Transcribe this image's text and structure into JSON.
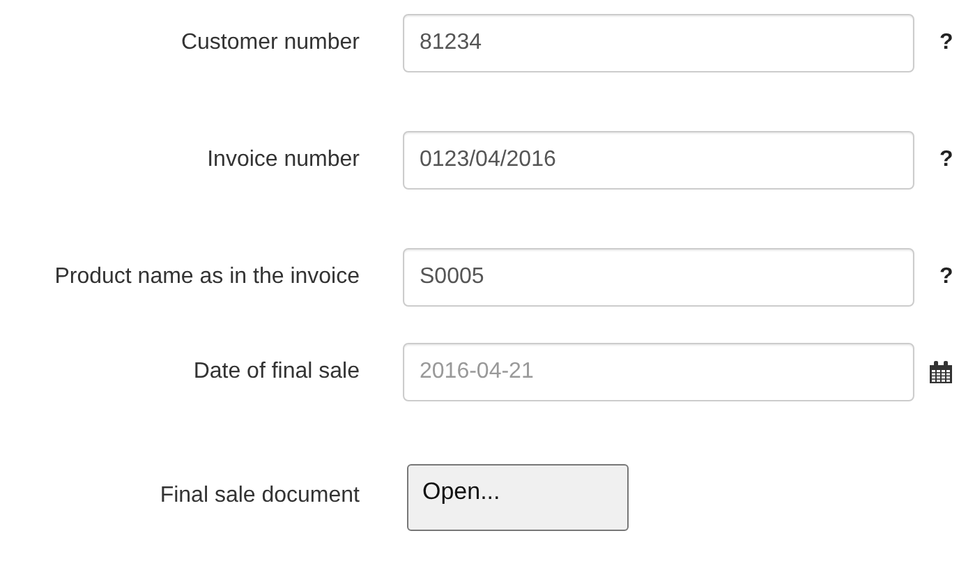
{
  "fields": [
    {
      "kind": "text",
      "label": "Customer number",
      "value": "81234",
      "help": "?"
    },
    {
      "kind": "text",
      "label": "Invoice number",
      "value": "0123/04/2016",
      "help": "?"
    },
    {
      "kind": "text",
      "label": "Product name as in the invoice",
      "value": "S0005",
      "help": "?"
    },
    {
      "kind": "date",
      "label": "Date of final sale",
      "placeholder": "2016-04-21"
    },
    {
      "kind": "file",
      "label": "Final sale document",
      "button": "Open..."
    }
  ]
}
